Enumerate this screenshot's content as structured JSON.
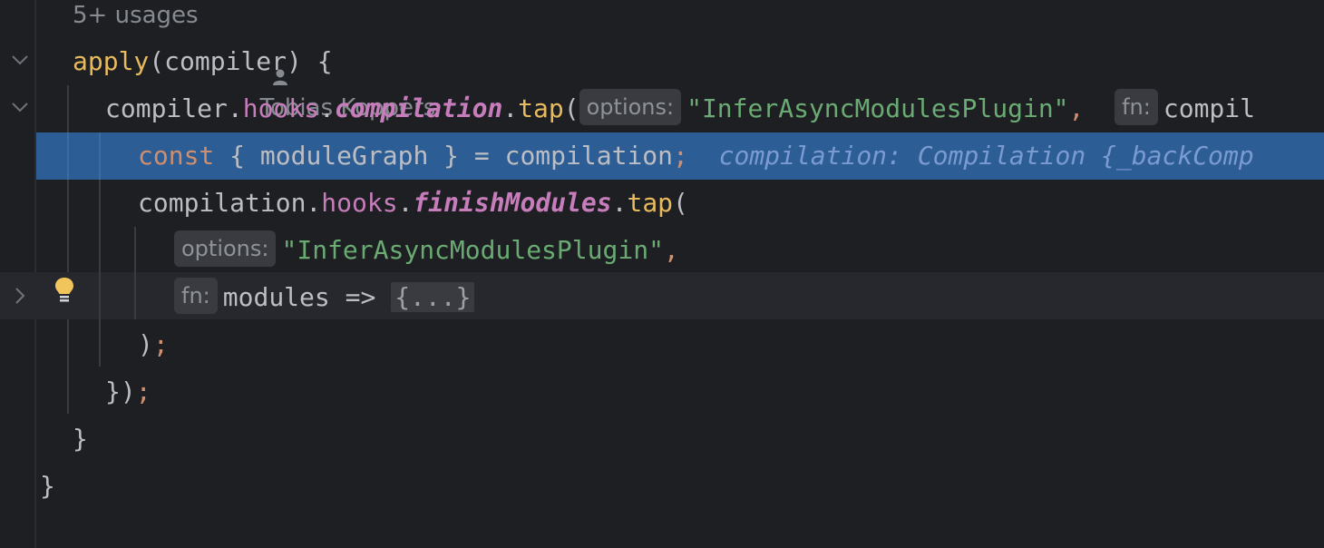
{
  "header": {
    "usages": "5+ usages",
    "author": "Tobias Koppers"
  },
  "code": {
    "l1": {
      "name": "apply",
      "rest": "(compiler) {"
    },
    "l2": {
      "obj": "compiler.",
      "hooks": "hooks",
      "dot1": ".",
      "compilation": "compilation",
      "dot2": ".",
      "tap": "tap",
      "paren": "(",
      "hint_options": "options:",
      "str": "\"InferAsyncModulesPlugin\"",
      "comma": ",",
      "hint_fn": "fn:",
      "tail": "compil"
    },
    "l3": {
      "const": "const",
      "body": " { moduleGraph } = compilation",
      "semi": ";",
      "inlay": "compilation: Compilation {_backComp"
    },
    "l4": {
      "obj": "compilation.",
      "hooks": "hooks",
      "dot1": ".",
      "finish": "finishModules",
      "dot2": ".",
      "tap": "tap",
      "paren": "("
    },
    "l5": {
      "hint_options": "options:",
      "str": "\"InferAsyncModulesPlugin\"",
      "comma": ","
    },
    "l6": {
      "hint_fn": "fn:",
      "arg": "modules => ",
      "folded": "{...}"
    },
    "l7": {
      "paren": ")",
      "semi": ";"
    },
    "l8": {
      "close": "})",
      "semi": ";"
    },
    "l9": {
      "close": "}"
    },
    "l10": {
      "close": "}"
    }
  },
  "icons": {
    "author": "person-icon",
    "fold_open": "chevron-down-icon",
    "fold_closed": "chevron-right-icon",
    "intention": "lightbulb-icon"
  },
  "colors": {
    "background": "#1e1f22",
    "selection": "#2c5d94",
    "keyword": "#cf8e6d",
    "string": "#6aab73",
    "property": "#c77dbb",
    "function": "#56a8f5"
  }
}
